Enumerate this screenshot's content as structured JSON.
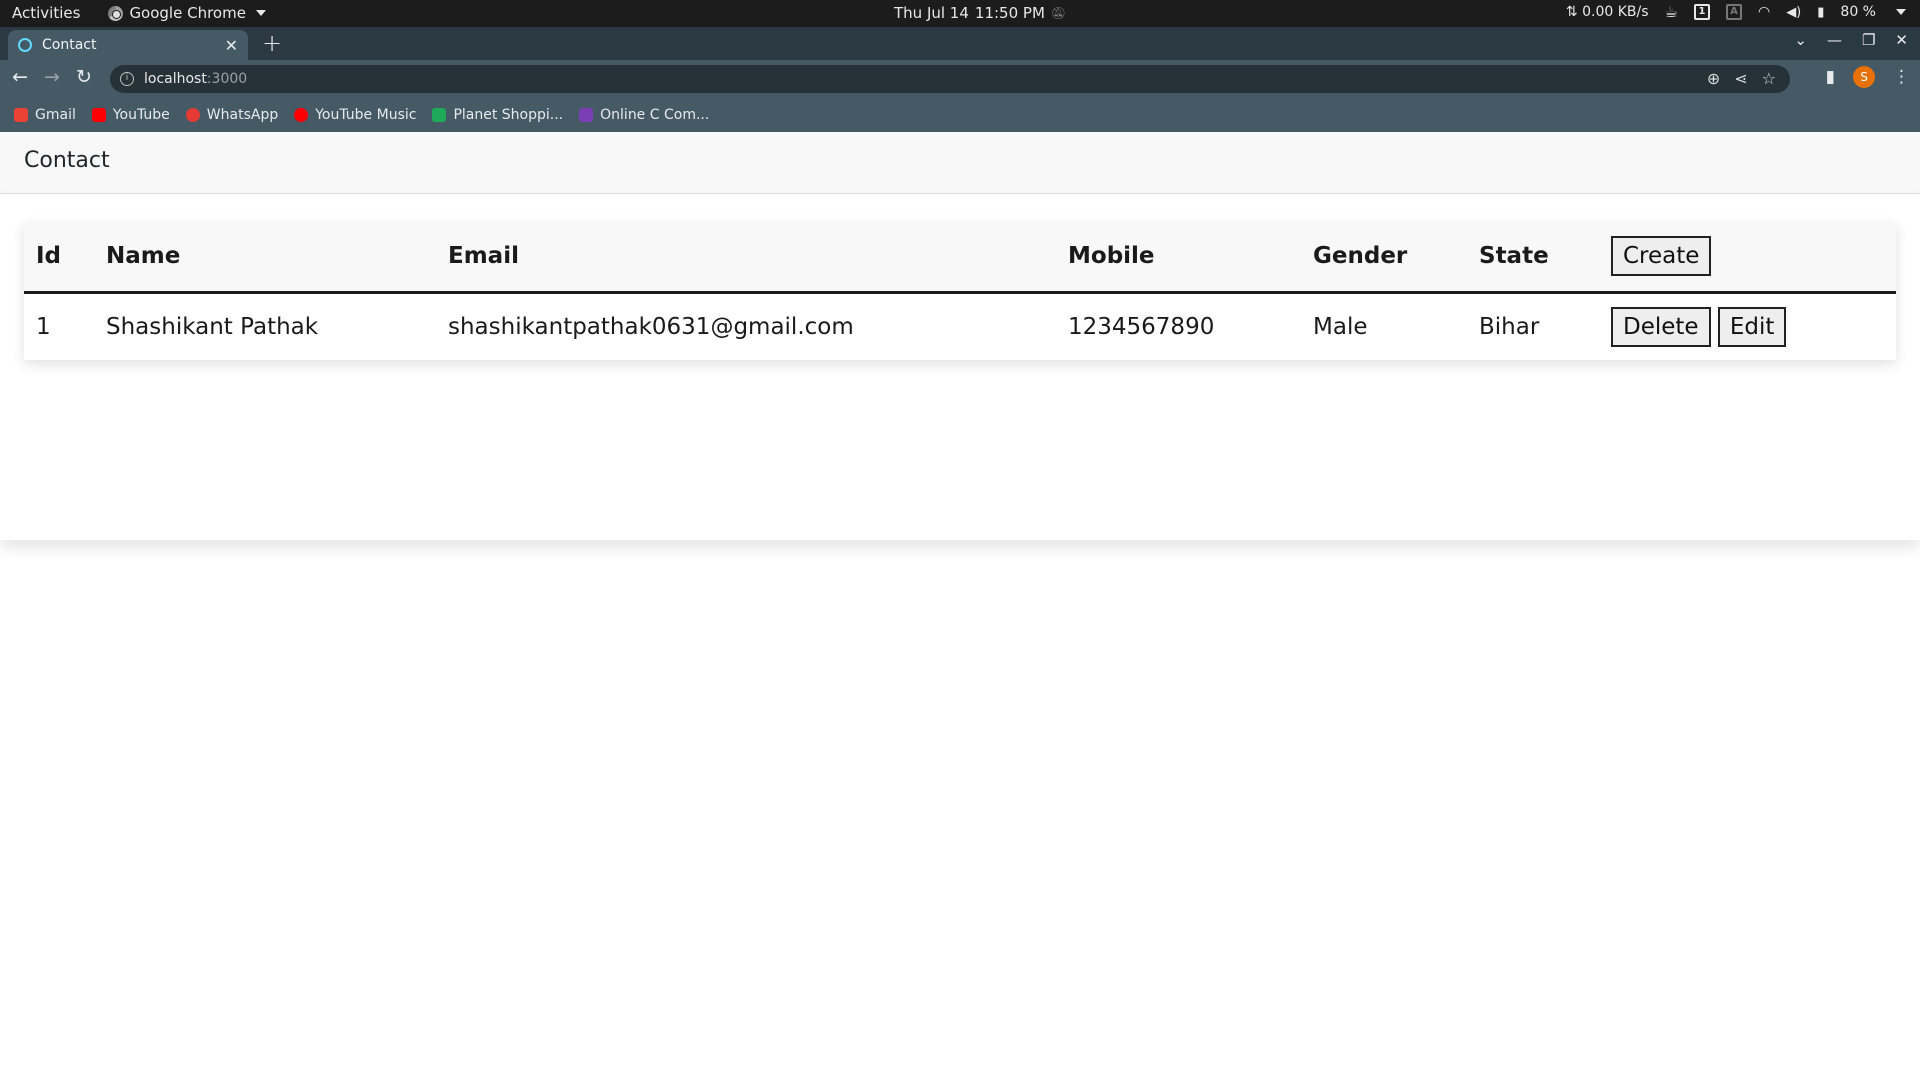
{
  "system_bar": {
    "activities": "Activities",
    "app_name": "Google Chrome",
    "clock_date": "Thu Jul 14",
    "clock_time": "11:50 PM",
    "net_speed": "⇅ 0.00 KB/s",
    "battery": "80 %"
  },
  "browser": {
    "tab_title": "Contact",
    "url_host": "localhost",
    "url_port": ":3000",
    "bookmarks": [
      {
        "label": "Gmail",
        "color": "#ea4335"
      },
      {
        "label": "YouTube",
        "color": "#ff0000"
      },
      {
        "label": "WhatsApp",
        "color": "#e53935"
      },
      {
        "label": "YouTube Music",
        "color": "#ff0000"
      },
      {
        "label": "Planet Shoppi...",
        "color": "#1faa59"
      },
      {
        "label": "Online C Com...",
        "color": "#7b3fb5"
      }
    ],
    "profile_initial": "S"
  },
  "page": {
    "brand": "Contact",
    "table": {
      "headers": {
        "id": "Id",
        "name": "Name",
        "email": "Email",
        "mobile": "Mobile",
        "gender": "Gender",
        "state": "State"
      },
      "create_label": "Create",
      "rows": [
        {
          "id": "1",
          "name": "Shashikant Pathak",
          "email": "shashikantpathak0631@gmail.com",
          "mobile": "1234567890",
          "gender": "Male",
          "state": "Bihar",
          "delete_label": "Delete",
          "edit_label": "Edit"
        }
      ]
    }
  },
  "colors": {
    "toolbar": "#455a64",
    "tabstrip": "#2b3a42",
    "navbar": "#f8f8f8"
  }
}
